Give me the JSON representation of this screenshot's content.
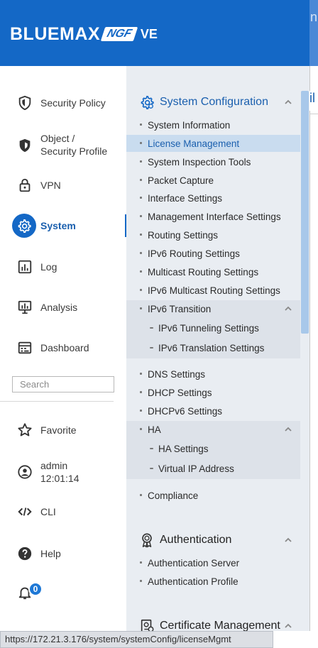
{
  "header": {
    "logo_main": "BLUEMAX",
    "logo_ngf": "NGF",
    "logo_ve": "VE",
    "edge_text": "n"
  },
  "leftnav": {
    "items": [
      {
        "label": "Security Policy",
        "icon": "shield-icon"
      },
      {
        "label": "Object /",
        "label2": "Security Profile",
        "icon": "object-shield-icon"
      },
      {
        "label": "VPN",
        "icon": "lock-icon"
      },
      {
        "label": "System",
        "icon": "gear-icon",
        "active": true
      },
      {
        "label": "Log",
        "icon": "bar-chart-icon"
      },
      {
        "label": "Analysis",
        "icon": "analysis-icon"
      },
      {
        "label": "Dashboard",
        "icon": "dashboard-icon"
      }
    ],
    "search_placeholder": "Search",
    "bottom": [
      {
        "label": "Favorite",
        "icon": "star-icon"
      },
      {
        "label": "admin",
        "label2": "12:01:14",
        "icon": "user-icon"
      },
      {
        "label": "CLI",
        "icon": "code-icon"
      },
      {
        "label": "Help",
        "icon": "help-icon"
      }
    ],
    "notification_count": "0"
  },
  "submenu": {
    "system_config": {
      "title": "System Configuration",
      "items": [
        "System Information",
        "License Management",
        "System Inspection Tools",
        "Packet Capture",
        "Interface Settings",
        "Management Interface Settings",
        "Routing Settings",
        "IPv6 Routing Settings",
        "Multicast Routing Settings",
        "IPv6 Multicast Routing Settings"
      ],
      "ipv6_transition": {
        "label": "IPv6 Transition",
        "children": [
          "IPv6 Tunneling Settings",
          "IPv6 Translation Settings"
        ]
      },
      "items2": [
        "DNS Settings",
        "DHCP Settings",
        "DHCPv6 Settings"
      ],
      "ha": {
        "label": "HA",
        "children": [
          "HA Settings",
          "Virtual IP Address"
        ]
      },
      "items3": [
        "Compliance"
      ]
    },
    "authentication": {
      "title": "Authentication",
      "items": [
        "Authentication Server",
        "Authentication Profile"
      ]
    },
    "certificate": {
      "title": "Certificate Management"
    }
  },
  "edge_tab_text": "il",
  "statusbar": {
    "url": "https://172.21.3.176/system/systemConfig/licenseMgmt"
  },
  "colors": {
    "brand": "#1468c6",
    "panel": "#e9edf2",
    "selected": "#c9dcef"
  }
}
